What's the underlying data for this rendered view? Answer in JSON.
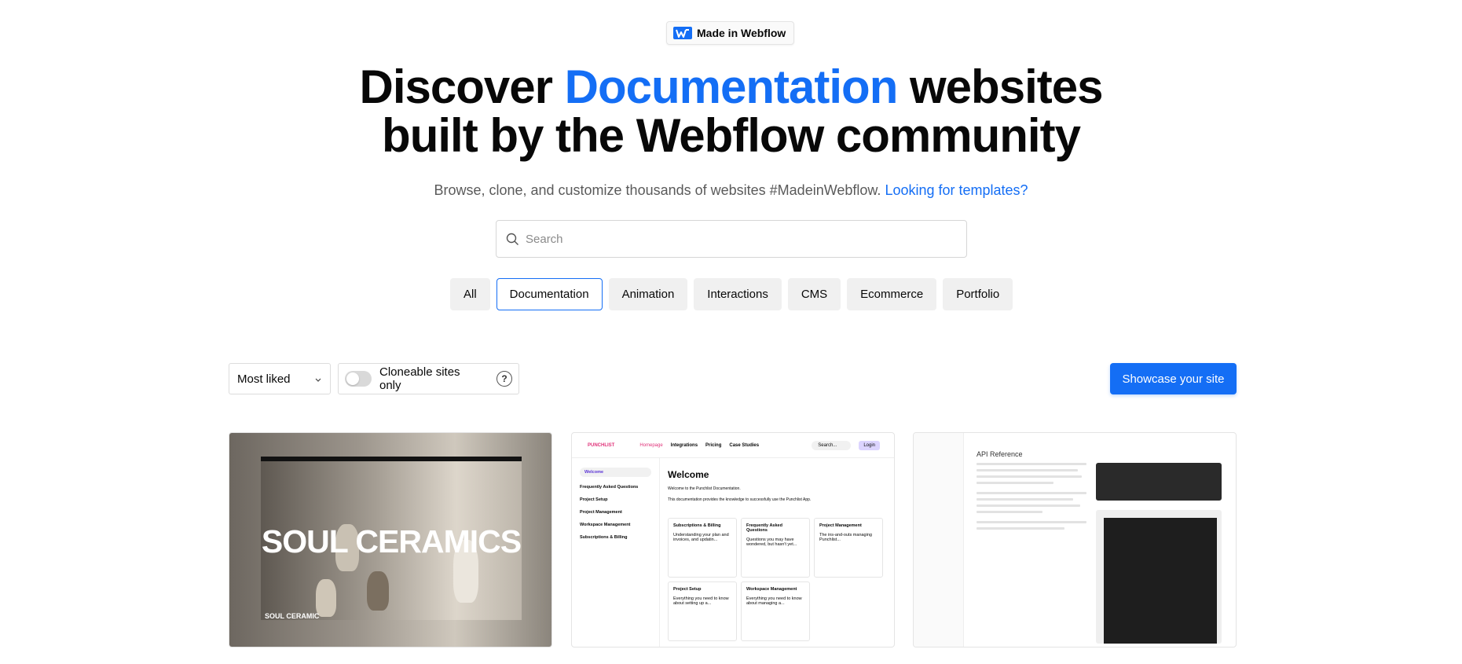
{
  "badge": {
    "label": "Made in Webflow"
  },
  "hero": {
    "title_pre": "Discover ",
    "title_accent": "Documentation",
    "title_post": " websites",
    "title_line2": "built by the Webflow community"
  },
  "subtitle": {
    "text": "Browse, clone, and customize thousands of websites #MadeinWebflow.",
    "link": "Looking for templates?"
  },
  "search": {
    "placeholder": "Search"
  },
  "filters": [
    "All",
    "Documentation",
    "Animation",
    "Interactions",
    "CMS",
    "Ecommerce",
    "Portfolio"
  ],
  "active_filter": "Documentation",
  "toolbar": {
    "sort_value": "Most liked",
    "clone_label": "Cloneable sites only",
    "help": "?",
    "showcase_label": "Showcase your site"
  },
  "cards": [
    {
      "title_text": "SOUL CERAMICS",
      "small_text": "SOUL CERAMIC"
    },
    {
      "brand": "PUNCHLIST",
      "nav": [
        "Homepage",
        "Integrations",
        "Pricing",
        "Case Studies"
      ],
      "search": "Search...",
      "login": "Login",
      "sidebar": [
        "Welcome",
        "Frequently Asked Questions",
        "Project Setup",
        "Project Management",
        "Workspace Management",
        "Subscriptions & Billing"
      ],
      "heading": "Welcome",
      "intro1": "Welcome to the Punchlist Documentation.",
      "intro2": "This documentation provides the knowledge to successfully use the Punchlist App.",
      "tiles": [
        {
          "title": "Subscriptions & Billing",
          "text": "Understanding your plan and invoices, and updatin..."
        },
        {
          "title": "Frequently Asked Questions",
          "text": "Questions you may have wondered, but hasn't yet..."
        },
        {
          "title": "Project Management",
          "text": "The ins-and-outs managing Punchlist..."
        },
        {
          "title": "Project Setup",
          "text": "Everything you need to know about setting up a..."
        },
        {
          "title": "Workspace Management",
          "text": "Everything you need to know about managing a..."
        }
      ]
    },
    {
      "heading": "API Reference"
    }
  ]
}
